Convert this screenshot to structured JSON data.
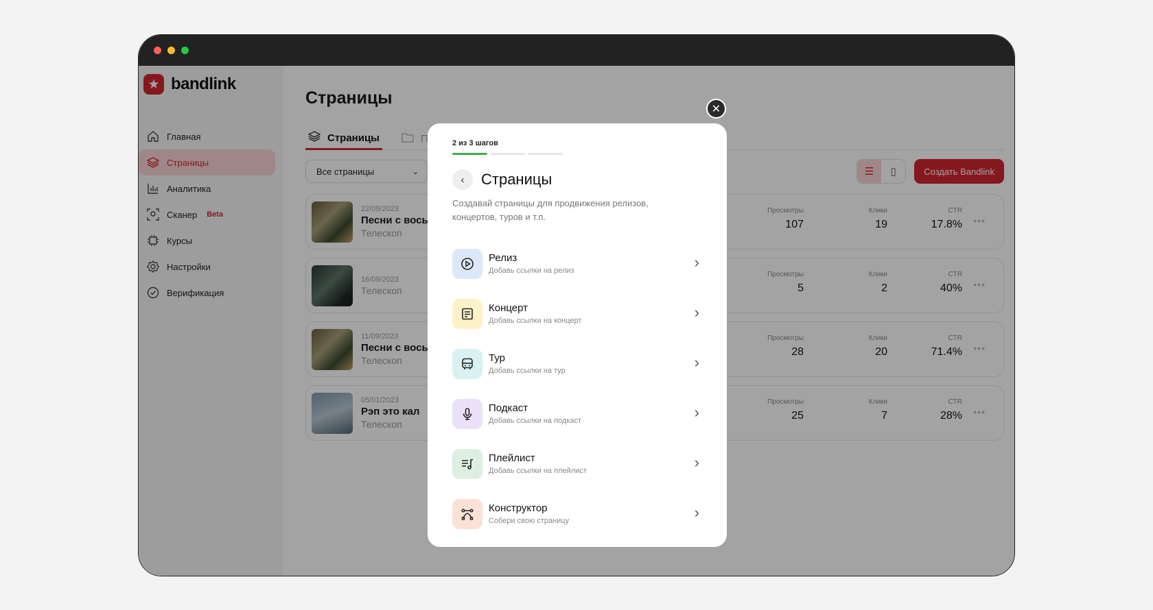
{
  "app": {
    "logo_text": "bandlink",
    "logo_icon": "star-icon"
  },
  "sidebar": {
    "items": [
      {
        "label": "Главная",
        "icon": "home-icon"
      },
      {
        "label": "Страницы",
        "icon": "layers-icon"
      },
      {
        "label": "Аналитика",
        "icon": "chart-icon"
      },
      {
        "label": "Сканер",
        "badge": "Beta",
        "icon": "scanner-icon"
      },
      {
        "label": "Курсы",
        "icon": "chip-icon"
      },
      {
        "label": "Настройки",
        "icon": "gear-icon"
      },
      {
        "label": "Верификация",
        "icon": "check-circle-icon"
      }
    ]
  },
  "main": {
    "title": "Страницы",
    "tabs": [
      {
        "label": "Страницы"
      },
      {
        "label": "Па"
      }
    ],
    "filter_value": "Все страницы",
    "create_label": "Создать Bandlink",
    "metric_labels": {
      "views": "Просмотры",
      "clicks": "Клики",
      "ctr": "CTR"
    },
    "cards": [
      {
        "date": "22/09/2023",
        "title": "Песни с восьм",
        "artist": "Телескоп",
        "views": "107",
        "clicks": "19",
        "ctr": "17.8%"
      },
      {
        "date": "16/09/2023",
        "title": "",
        "artist": "Телескоп",
        "views": "5",
        "clicks": "2",
        "ctr": "40%"
      },
      {
        "date": "11/09/2023",
        "title": "Песни с восьм",
        "artist": "Телескоп",
        "views": "28",
        "clicks": "20",
        "ctr": "71.4%"
      },
      {
        "date": "05/01/2023",
        "title": "Рэп это кал",
        "artist": "Телескоп",
        "views": "25",
        "clicks": "7",
        "ctr": "28%"
      }
    ]
  },
  "modal": {
    "steps_label": "2 из 3 шагов",
    "steps_total": 3,
    "steps_done": 1,
    "title": "Страницы",
    "description": "Создавай страницы для продвижения релизов, концертов, туров и т.п.",
    "options": [
      {
        "title": "Релиз",
        "subtitle": "Добавь ссылки на релиз",
        "icon": "play-circle-icon",
        "color": "#dce8f8"
      },
      {
        "title": "Концерт",
        "subtitle": "Добавь ссылки на концерт",
        "icon": "ticket-icon",
        "color": "#fdf1c8"
      },
      {
        "title": "Тур",
        "subtitle": "Добавь ссылки на тур",
        "icon": "bus-icon",
        "color": "#d9f1f1"
      },
      {
        "title": "Подкаст",
        "subtitle": "Добавь ссылки на подкаст",
        "icon": "microphone-icon",
        "color": "#ece1fb"
      },
      {
        "title": "Плейлист",
        "subtitle": "Добавь ссылки на плейлист",
        "icon": "playlist-icon",
        "color": "#deefe2"
      },
      {
        "title": "Конструктор",
        "subtitle": "Собери свою страницу",
        "icon": "vector-icon",
        "color": "#fce1d6"
      }
    ]
  },
  "colors": {
    "brand": "#d0262f",
    "progress_done": "#3fae4d"
  }
}
